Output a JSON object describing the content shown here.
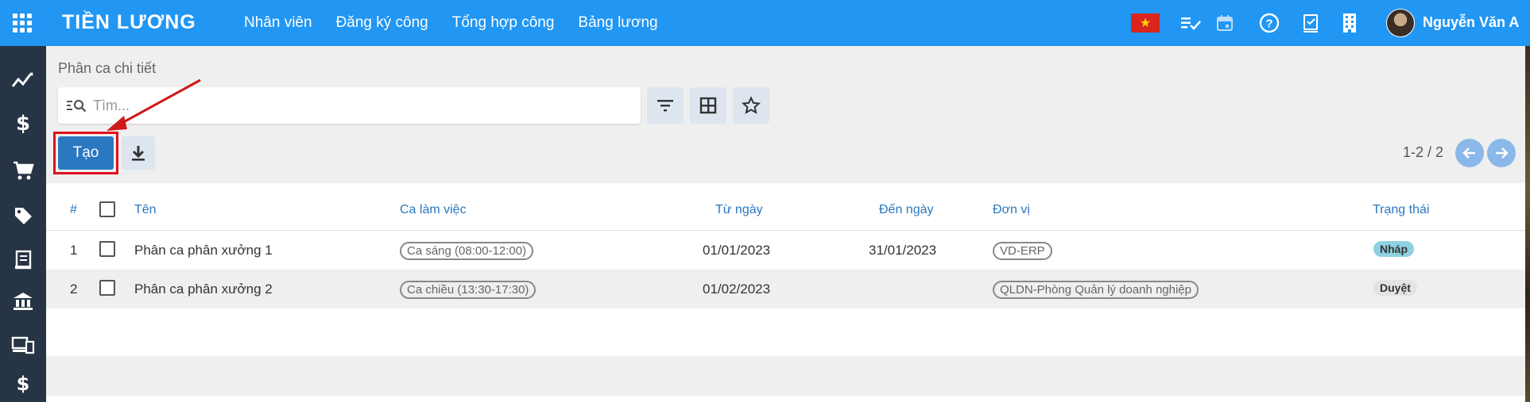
{
  "app": {
    "title": "TIỀN LƯƠNG",
    "menu": [
      "Nhân viên",
      "Đăng ký công",
      "Tổng hợp công",
      "Bảng lương"
    ],
    "user_name": "Nguyễn Văn A",
    "brand_color": "#2196f3"
  },
  "sidebar_icons": [
    "chart-line-icon",
    "dollar-icon",
    "cart-icon",
    "tag-icon",
    "receipt-icon",
    "bank-icon",
    "devices-icon",
    "dollar-stack-icon"
  ],
  "page": {
    "breadcrumb": "Phân ca chi tiết",
    "search_placeholder": "Tìm...",
    "create_label": "Tạo",
    "pager": "1-2 / 2"
  },
  "table": {
    "headers": {
      "num": "#",
      "name": "Tên",
      "shift": "Ca làm việc",
      "from": "Từ ngày",
      "to": "Đến ngày",
      "unit": "Đơn vị",
      "status": "Trạng thái"
    },
    "rows": [
      {
        "num": "1",
        "name": "Phân ca phân xưởng 1",
        "shift": "Ca sáng (08:00-12:00)",
        "from": "01/01/2023",
        "to": "31/01/2023",
        "unit": "VD-ERP",
        "status": "Nháp",
        "status_color": "#8fd1e0"
      },
      {
        "num": "2",
        "name": "Phân ca phân xưởng 2",
        "shift": "Ca chiều (13:30-17:30)",
        "from": "01/02/2023",
        "to": "",
        "unit": "QLDN-Phòng Quản lý doanh nghiệp",
        "status": "Duyệt",
        "status_color": "#e3e3e3"
      }
    ]
  }
}
